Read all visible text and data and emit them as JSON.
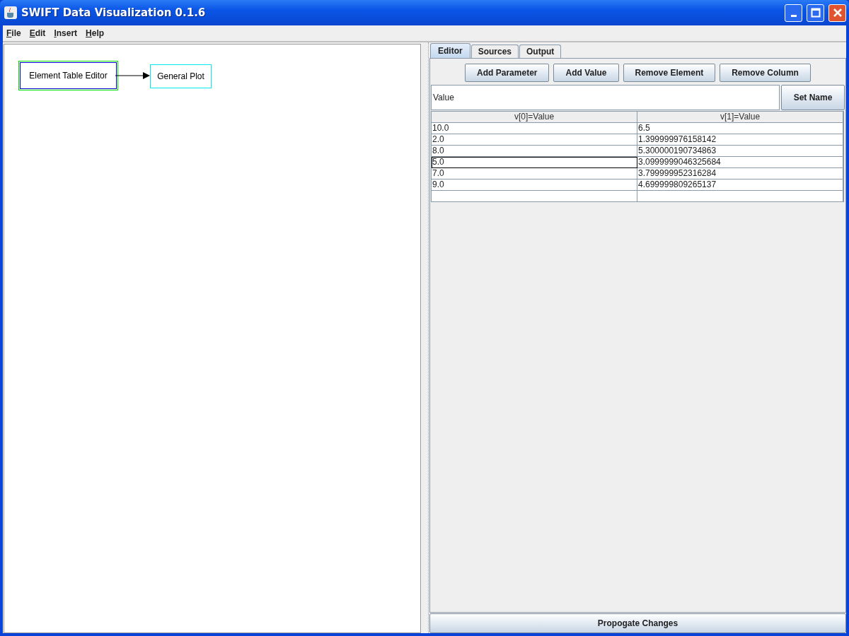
{
  "window": {
    "title": "SWIFT Data Visualization 0.1.6"
  },
  "menu": [
    "File",
    "Edit",
    "Insert",
    "Help"
  ],
  "diagram": {
    "nodes": [
      {
        "label": "Element Table Editor",
        "selected": true
      },
      {
        "label": "General Plot",
        "selected": false
      }
    ]
  },
  "tabs": [
    {
      "label": "Editor",
      "selected": true
    },
    {
      "label": "Sources",
      "selected": false
    },
    {
      "label": "Output",
      "selected": false
    }
  ],
  "toolbar": [
    "Add Parameter",
    "Add Value",
    "Remove Element",
    "Remove Column"
  ],
  "name_field": {
    "value": "Value",
    "button": "Set Name"
  },
  "table": {
    "columns": [
      "v[0]=Value",
      "v[1]=Value"
    ],
    "rows": [
      {
        "cells": [
          {
            "text": "10.0",
            "focused": false
          },
          {
            "text": "6.5",
            "focused": false
          }
        ]
      },
      {
        "cells": [
          {
            "text": "2.0",
            "focused": false
          },
          {
            "text": "1.399999976158142",
            "focused": false
          }
        ]
      },
      {
        "cells": [
          {
            "text": "8.0",
            "focused": false
          },
          {
            "text": "5.300000190734863",
            "focused": false
          }
        ]
      },
      {
        "cells": [
          {
            "text": "5.0",
            "focused": true
          },
          {
            "text": "3.0999999046325684",
            "focused": false
          }
        ]
      },
      {
        "cells": [
          {
            "text": "7.0",
            "focused": false
          },
          {
            "text": "3.799999952316284",
            "focused": false
          }
        ]
      },
      {
        "cells": [
          {
            "text": "9.0",
            "focused": false
          },
          {
            "text": "4.699999809265137",
            "focused": false
          }
        ]
      }
    ]
  },
  "footer_button": "Propogate Changes"
}
